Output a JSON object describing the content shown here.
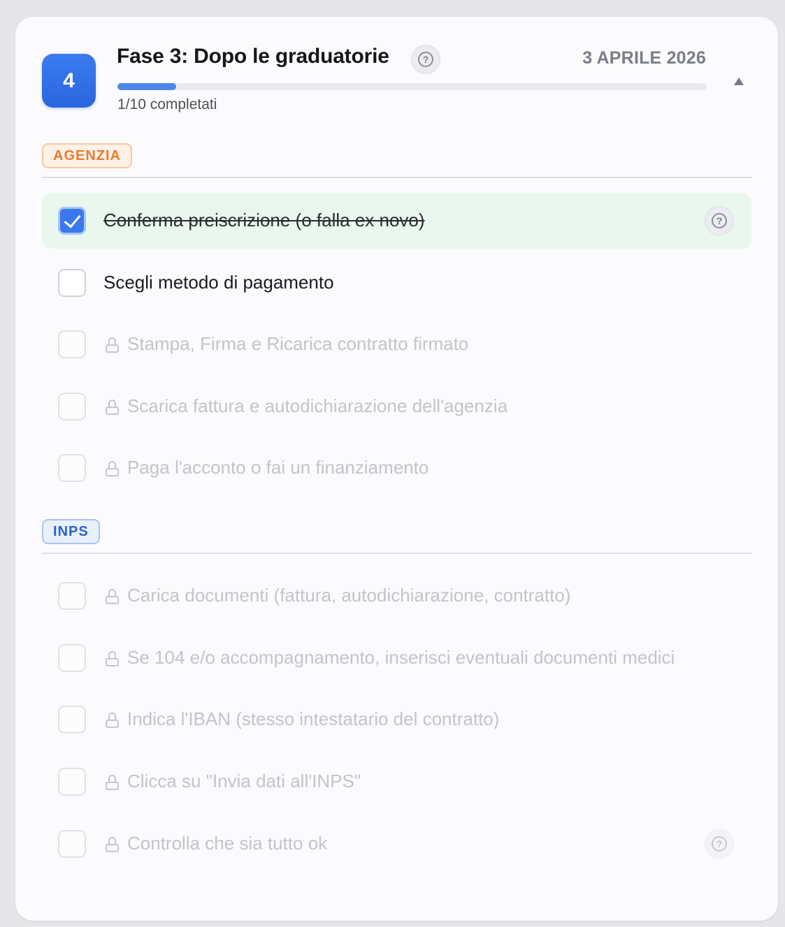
{
  "phase": {
    "number": "4",
    "title": "Fase 3: Dopo le graduatorie",
    "date": "3 APRILE 2026",
    "progress_text": "1/10 completati",
    "progress_fraction": 0.1,
    "expanded": true
  },
  "colors": {
    "accent": "#3a78ec",
    "done_bg": "#eaf7ef",
    "agenzia_tag": "#ea7b2e",
    "inps_tag": "#2e62c8"
  },
  "sections": [
    {
      "tag": "AGENZIA",
      "tasks": [
        {
          "label": "Conferma preiscrizione (o falla ex novo)",
          "state": "done",
          "has_help": true
        },
        {
          "label": "Scegli metodo di pagamento",
          "state": "open",
          "has_help": false
        },
        {
          "label": "Stampa, Firma e Ricarica contratto firmato",
          "state": "locked",
          "has_help": false
        },
        {
          "label": "Scarica fattura e autodichiarazione dell'agenzia",
          "state": "locked",
          "has_help": false
        },
        {
          "label": "Paga l'acconto o fai un finanziamento",
          "state": "locked",
          "has_help": false
        }
      ]
    },
    {
      "tag": "INPS",
      "tasks": [
        {
          "label": "Carica documenti (fattura, autodichiarazione, contratto)",
          "state": "locked",
          "has_help": false
        },
        {
          "label": "Se 104 e/o accompagnamento, inserisci eventuali documenti medici",
          "state": "locked",
          "has_help": false
        },
        {
          "label": "Indica l'IBAN (stesso intestatario del contratto)",
          "state": "locked",
          "has_help": false
        },
        {
          "label": "Clicca su \"Invia dati all'INPS\"",
          "state": "locked",
          "has_help": false
        },
        {
          "label": "Controlla che sia tutto ok",
          "state": "locked",
          "has_help": true
        }
      ]
    }
  ],
  "icons": {
    "help": "question-circle-icon",
    "lock": "lock-icon",
    "collapse": "chevron-up-icon",
    "check": "check-icon"
  }
}
